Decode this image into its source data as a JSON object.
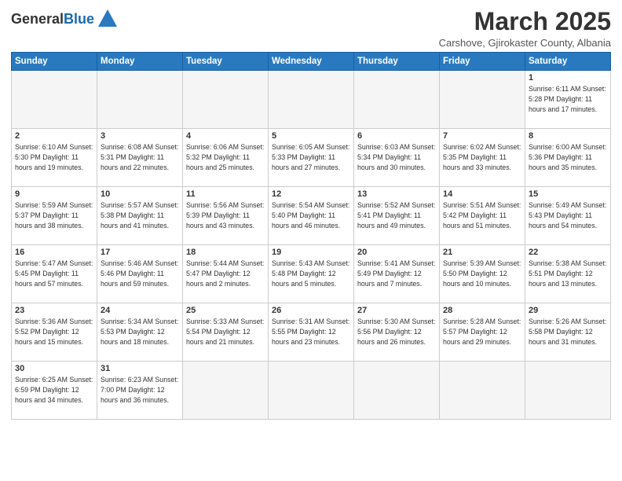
{
  "logo": {
    "general": "General",
    "blue": "Blue"
  },
  "title": "March 2025",
  "subtitle": "Carshove, Gjirokaster County, Albania",
  "weekdays": [
    "Sunday",
    "Monday",
    "Tuesday",
    "Wednesday",
    "Thursday",
    "Friday",
    "Saturday"
  ],
  "weeks": [
    [
      {
        "day": "",
        "info": ""
      },
      {
        "day": "",
        "info": ""
      },
      {
        "day": "",
        "info": ""
      },
      {
        "day": "",
        "info": ""
      },
      {
        "day": "",
        "info": ""
      },
      {
        "day": "",
        "info": ""
      },
      {
        "day": "1",
        "info": "Sunrise: 6:11 AM\nSunset: 5:28 PM\nDaylight: 11 hours\nand 17 minutes."
      }
    ],
    [
      {
        "day": "2",
        "info": "Sunrise: 6:10 AM\nSunset: 5:30 PM\nDaylight: 11 hours\nand 19 minutes."
      },
      {
        "day": "3",
        "info": "Sunrise: 6:08 AM\nSunset: 5:31 PM\nDaylight: 11 hours\nand 22 minutes."
      },
      {
        "day": "4",
        "info": "Sunrise: 6:06 AM\nSunset: 5:32 PM\nDaylight: 11 hours\nand 25 minutes."
      },
      {
        "day": "5",
        "info": "Sunrise: 6:05 AM\nSunset: 5:33 PM\nDaylight: 11 hours\nand 27 minutes."
      },
      {
        "day": "6",
        "info": "Sunrise: 6:03 AM\nSunset: 5:34 PM\nDaylight: 11 hours\nand 30 minutes."
      },
      {
        "day": "7",
        "info": "Sunrise: 6:02 AM\nSunset: 5:35 PM\nDaylight: 11 hours\nand 33 minutes."
      },
      {
        "day": "8",
        "info": "Sunrise: 6:00 AM\nSunset: 5:36 PM\nDaylight: 11 hours\nand 35 minutes."
      }
    ],
    [
      {
        "day": "9",
        "info": "Sunrise: 5:59 AM\nSunset: 5:37 PM\nDaylight: 11 hours\nand 38 minutes."
      },
      {
        "day": "10",
        "info": "Sunrise: 5:57 AM\nSunset: 5:38 PM\nDaylight: 11 hours\nand 41 minutes."
      },
      {
        "day": "11",
        "info": "Sunrise: 5:56 AM\nSunset: 5:39 PM\nDaylight: 11 hours\nand 43 minutes."
      },
      {
        "day": "12",
        "info": "Sunrise: 5:54 AM\nSunset: 5:40 PM\nDaylight: 11 hours\nand 46 minutes."
      },
      {
        "day": "13",
        "info": "Sunrise: 5:52 AM\nSunset: 5:41 PM\nDaylight: 11 hours\nand 49 minutes."
      },
      {
        "day": "14",
        "info": "Sunrise: 5:51 AM\nSunset: 5:42 PM\nDaylight: 11 hours\nand 51 minutes."
      },
      {
        "day": "15",
        "info": "Sunrise: 5:49 AM\nSunset: 5:43 PM\nDaylight: 11 hours\nand 54 minutes."
      }
    ],
    [
      {
        "day": "16",
        "info": "Sunrise: 5:47 AM\nSunset: 5:45 PM\nDaylight: 11 hours\nand 57 minutes."
      },
      {
        "day": "17",
        "info": "Sunrise: 5:46 AM\nSunset: 5:46 PM\nDaylight: 11 hours\nand 59 minutes."
      },
      {
        "day": "18",
        "info": "Sunrise: 5:44 AM\nSunset: 5:47 PM\nDaylight: 12 hours\nand 2 minutes."
      },
      {
        "day": "19",
        "info": "Sunrise: 5:43 AM\nSunset: 5:48 PM\nDaylight: 12 hours\nand 5 minutes."
      },
      {
        "day": "20",
        "info": "Sunrise: 5:41 AM\nSunset: 5:49 PM\nDaylight: 12 hours\nand 7 minutes."
      },
      {
        "day": "21",
        "info": "Sunrise: 5:39 AM\nSunset: 5:50 PM\nDaylight: 12 hours\nand 10 minutes."
      },
      {
        "day": "22",
        "info": "Sunrise: 5:38 AM\nSunset: 5:51 PM\nDaylight: 12 hours\nand 13 minutes."
      }
    ],
    [
      {
        "day": "23",
        "info": "Sunrise: 5:36 AM\nSunset: 5:52 PM\nDaylight: 12 hours\nand 15 minutes."
      },
      {
        "day": "24",
        "info": "Sunrise: 5:34 AM\nSunset: 5:53 PM\nDaylight: 12 hours\nand 18 minutes."
      },
      {
        "day": "25",
        "info": "Sunrise: 5:33 AM\nSunset: 5:54 PM\nDaylight: 12 hours\nand 21 minutes."
      },
      {
        "day": "26",
        "info": "Sunrise: 5:31 AM\nSunset: 5:55 PM\nDaylight: 12 hours\nand 23 minutes."
      },
      {
        "day": "27",
        "info": "Sunrise: 5:30 AM\nSunset: 5:56 PM\nDaylight: 12 hours\nand 26 minutes."
      },
      {
        "day": "28",
        "info": "Sunrise: 5:28 AM\nSunset: 5:57 PM\nDaylight: 12 hours\nand 29 minutes."
      },
      {
        "day": "29",
        "info": "Sunrise: 5:26 AM\nSunset: 5:58 PM\nDaylight: 12 hours\nand 31 minutes."
      }
    ],
    [
      {
        "day": "30",
        "info": "Sunrise: 6:25 AM\nSunset: 6:59 PM\nDaylight: 12 hours\nand 34 minutes."
      },
      {
        "day": "31",
        "info": "Sunrise: 6:23 AM\nSunset: 7:00 PM\nDaylight: 12 hours\nand 36 minutes."
      },
      {
        "day": "",
        "info": ""
      },
      {
        "day": "",
        "info": ""
      },
      {
        "day": "",
        "info": ""
      },
      {
        "day": "",
        "info": ""
      },
      {
        "day": "",
        "info": ""
      }
    ]
  ]
}
